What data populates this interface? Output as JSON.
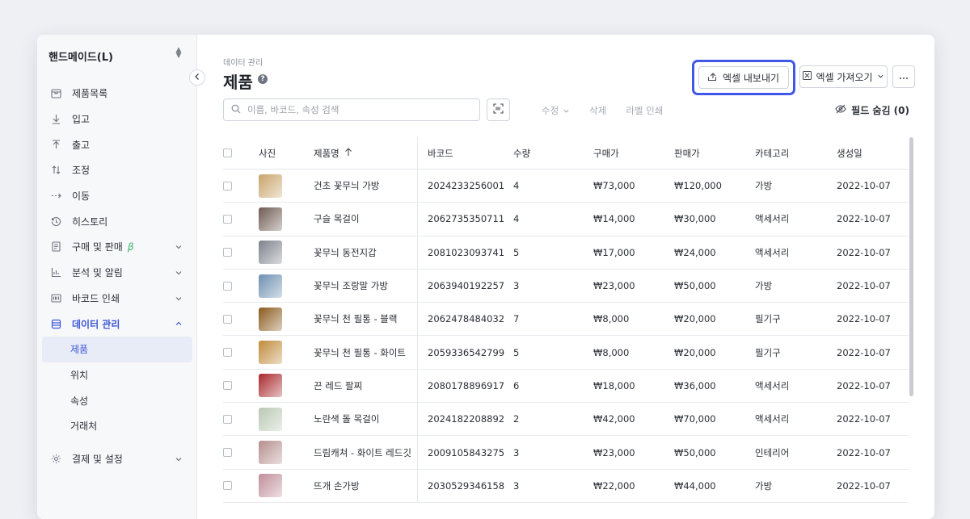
{
  "sidebar": {
    "org_name": "핸드메이드(L)",
    "items": [
      {
        "label": "제품목록",
        "icon": "box-icon"
      },
      {
        "label": "입고",
        "icon": "arrow-down-icon"
      },
      {
        "label": "출고",
        "icon": "arrow-up-icon"
      },
      {
        "label": "조정",
        "icon": "swap-vertical-icon"
      },
      {
        "label": "이동",
        "icon": "arrow-right-dashed-icon"
      },
      {
        "label": "히스토리",
        "icon": "history-icon"
      }
    ],
    "sections": [
      {
        "label": "구매 및 판매",
        "icon": "document-icon",
        "badge": "β"
      },
      {
        "label": "분석 및 알림",
        "icon": "bar-chart-icon"
      },
      {
        "label": "바코드 인쇄",
        "icon": "barcode-icon"
      },
      {
        "label": "데이터 관리",
        "icon": "database-icon"
      }
    ],
    "sub_items": [
      "제품",
      "위치",
      "속성",
      "거래처"
    ],
    "settings_label": "결제 및 설정"
  },
  "header": {
    "breadcrumb": "데이터 관리",
    "title": "제품",
    "export_label": "엑셀 내보내기",
    "import_label": "엑셀 가져오기"
  },
  "toolbar": {
    "search_placeholder": "이름, 바코드, 속성 검색",
    "edit_label": "수정",
    "delete_label": "삭제",
    "print_label": "라벨 인쇄",
    "field_hide_label": "필드 숨김 (0)"
  },
  "colors": {
    "accent": "#3c57d6",
    "highlight_border": "#4157e8",
    "beta": "#3bb36a"
  },
  "table": {
    "columns": [
      "사진",
      "제품명",
      "바코드",
      "수량",
      "구매가",
      "판매가",
      "카테고리",
      "생성일"
    ],
    "rows": [
      {
        "name": "건초 꽃무늬 가방",
        "barcode": "2024233256001",
        "qty": "4",
        "buy": "₩73,000",
        "sell": "₩120,000",
        "category": "가방",
        "date": "2022-10-07",
        "photo": "#c9a46a"
      },
      {
        "name": "구슬 목걸이",
        "barcode": "2062735350711",
        "qty": "4",
        "buy": "₩14,000",
        "sell": "₩30,000",
        "category": "액세서리",
        "date": "2022-10-07",
        "photo": "#6e5a52"
      },
      {
        "name": "꽃무늬 동전지갑",
        "barcode": "2081023093741",
        "qty": "5",
        "buy": "₩17,000",
        "sell": "₩24,000",
        "category": "액세서리",
        "date": "2022-10-07",
        "photo": "#7d828c"
      },
      {
        "name": "꽃무늬 조랑말 가방",
        "barcode": "2063940192257",
        "qty": "3",
        "buy": "₩23,000",
        "sell": "₩50,000",
        "category": "가방",
        "date": "2022-10-07",
        "photo": "#6c8fb0"
      },
      {
        "name": "꽃무늬 천 필통 - 블랙",
        "barcode": "2062478484032",
        "qty": "7",
        "buy": "₩8,000",
        "sell": "₩20,000",
        "category": "필기구",
        "date": "2022-10-07",
        "photo": "#8a5a1c"
      },
      {
        "name": "꽃무늬 천 필통 - 화이트",
        "barcode": "2059336542799",
        "qty": "5",
        "buy": "₩8,000",
        "sell": "₩20,000",
        "category": "필기구",
        "date": "2022-10-07",
        "photo": "#c08a3a"
      },
      {
        "name": "끈 레드 팔찌",
        "barcode": "2080178896917",
        "qty": "6",
        "buy": "₩18,000",
        "sell": "₩36,000",
        "category": "액세서리",
        "date": "2022-10-07",
        "photo": "#a8282c"
      },
      {
        "name": "노란색 돌 목걸이",
        "barcode": "2024182208892",
        "qty": "2",
        "buy": "₩42,000",
        "sell": "₩70,000",
        "category": "액세서리",
        "date": "2022-10-07",
        "photo": "#b9c8b4"
      },
      {
        "name": "드림캐쳐 - 화이트 레드깃",
        "barcode": "2009105843275",
        "qty": "3",
        "buy": "₩23,000",
        "sell": "₩50,000",
        "category": "인테리어",
        "date": "2022-10-07",
        "photo": "#b58f8e"
      },
      {
        "name": "뜨개 손가방",
        "barcode": "2030529346158",
        "qty": "3",
        "buy": "₩22,000",
        "sell": "₩44,000",
        "category": "가방",
        "date": "2022-10-07",
        "photo": "#c08e9a"
      }
    ]
  }
}
